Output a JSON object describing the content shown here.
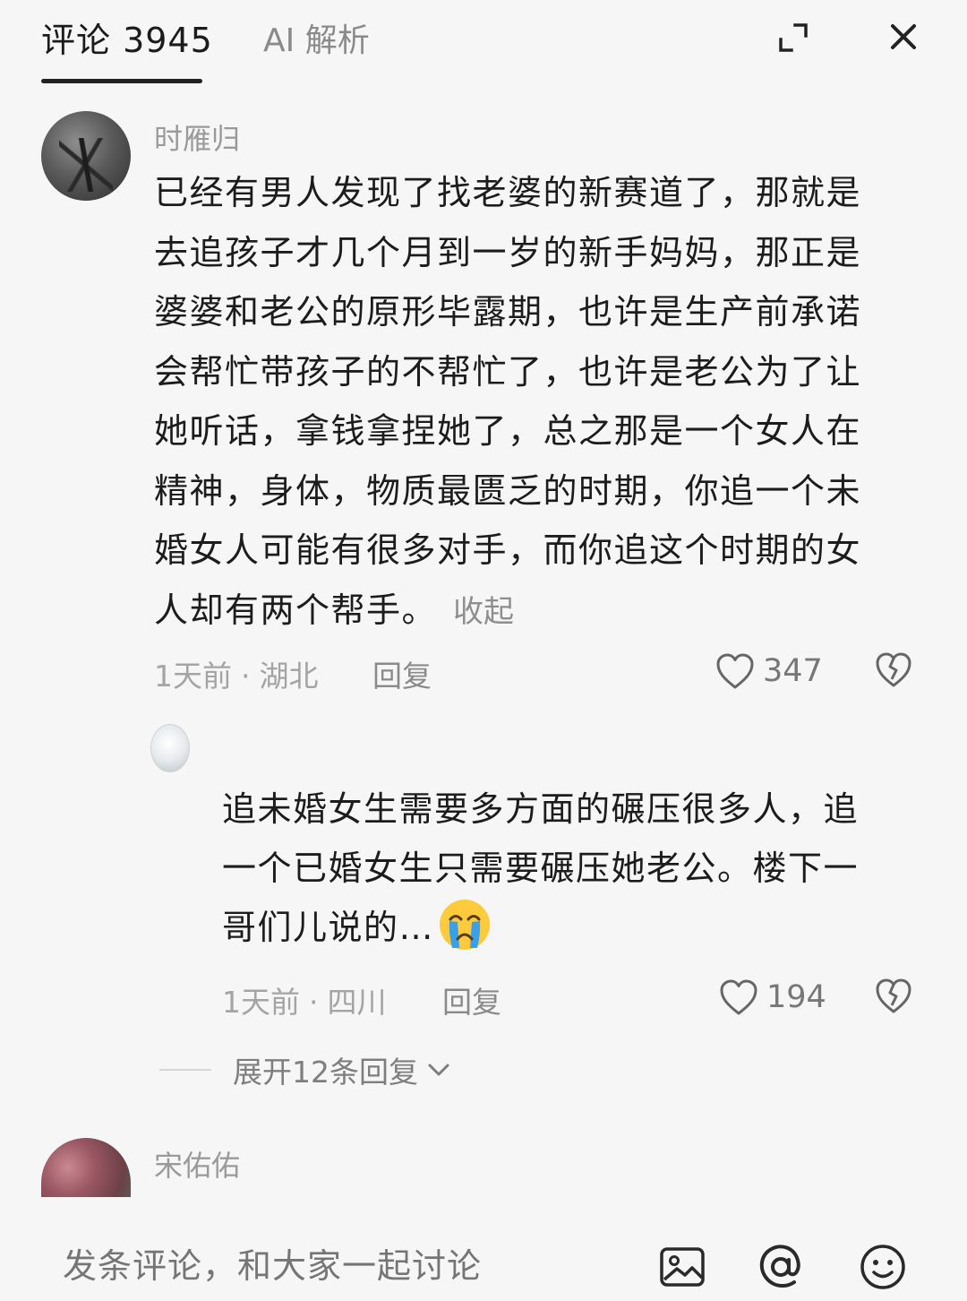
{
  "header": {
    "tab_comments": "评论 3945",
    "tab_ai": "AI 解析",
    "expand_icon": "expand-icon",
    "close_icon": "close-icon"
  },
  "comments": [
    {
      "username": "时雁归",
      "lines": [
        "已经有男人发现了找老婆的新赛道了，那就是",
        "去追孩子才几个月到一岁的新手妈妈，那正是",
        "婆婆和老公的原形毕露期，也许是生产前承诺",
        "会帮忙带孩子的不帮忙了，也许是老公为了让",
        "她听话，拿钱拿捏她了，总之那是一个女人在",
        "精神，身体，物质最匮乏的时期，你追一个未",
        "婚女人可能有很多对手，而你追这个时期的女",
        "人却有两个帮手。"
      ],
      "collapse_label": "收起",
      "time": "1天前",
      "location": "湖北",
      "reply_label": "回复",
      "likes": "347"
    },
    {
      "username": "",
      "lines": [
        "追未婚女生需要多方面的碾压很多人，追",
        "一个已婚女生只需要碾压她老公。楼下一",
        "哥们儿说的…"
      ],
      "emoji": "crying-face",
      "time": "1天前",
      "location": "四川",
      "reply_label": "回复",
      "likes": "194"
    },
    {
      "username": "宋佑佑"
    }
  ],
  "expand_replies_label": "展开12条回复",
  "bottom_bar": {
    "input_placeholder": "发条评论，和大家一起讨论",
    "icons": [
      "image-icon",
      "at-icon",
      "emoji-icon"
    ]
  }
}
